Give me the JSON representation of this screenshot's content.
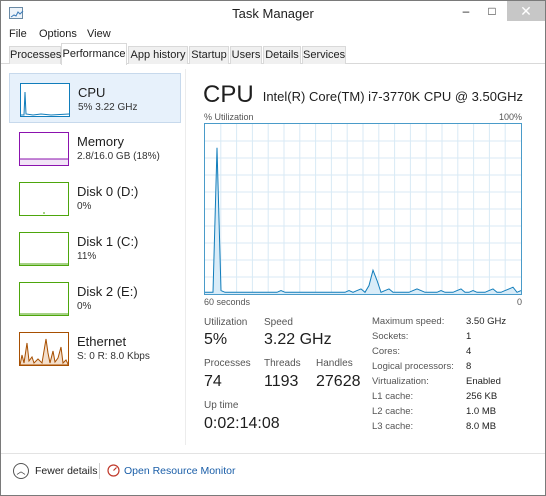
{
  "window": {
    "title": "Task Manager",
    "minimize_glyph": "–",
    "maximize_glyph": "□",
    "close_glyph": "✕"
  },
  "menu": [
    "File",
    "Options",
    "View"
  ],
  "tabs": [
    {
      "label": "Processes",
      "active": false
    },
    {
      "label": "Performance",
      "active": true
    },
    {
      "label": "App history",
      "active": false
    },
    {
      "label": "Startup",
      "active": false
    },
    {
      "label": "Users",
      "active": false
    },
    {
      "label": "Details",
      "active": false
    },
    {
      "label": "Services",
      "active": false
    }
  ],
  "resources": [
    {
      "name": "CPU",
      "sub": "5%  3.22 GHz",
      "color": "#117dbb",
      "selected": true
    },
    {
      "name": "Memory",
      "sub": "2.8/16.0 GB (18%)",
      "color": "#8b12ae",
      "selected": false
    },
    {
      "name": "Disk 0 (D:)",
      "sub": "0%",
      "color": "#4da60c",
      "selected": false
    },
    {
      "name": "Disk 1 (C:)",
      "sub": "11%",
      "color": "#4da60c",
      "selected": false
    },
    {
      "name": "Disk 2 (E:)",
      "sub": "0%",
      "color": "#4da60c",
      "selected": false
    },
    {
      "name": "Ethernet",
      "sub": "S: 0  R: 8.0 Kbps",
      "color": "#a74f01",
      "selected": false
    }
  ],
  "cpu": {
    "title": "CPU",
    "model": "Intel(R) Core(TM) i7-3770K CPU @ 3.50GHz",
    "util_label": "% Utilization",
    "util_max": "100%",
    "axis_left": "60 seconds",
    "axis_right": "0",
    "graph_color": "#117dbb",
    "utilization_history_percent": [
      1,
      1,
      1,
      86,
      2,
      1,
      1,
      1,
      1,
      1,
      1,
      1,
      1,
      1,
      1,
      1,
      1,
      1,
      1,
      2,
      1,
      1,
      1,
      1,
      1,
      1,
      1,
      1,
      1,
      1,
      1,
      1,
      1,
      1,
      1,
      1,
      2,
      1,
      2,
      3,
      1,
      5,
      14,
      8,
      1,
      2,
      3,
      1,
      1,
      1,
      1,
      1,
      2,
      3,
      2,
      1,
      1,
      1,
      1,
      2,
      1,
      1,
      1,
      2,
      3,
      1,
      1,
      2,
      1,
      1,
      1,
      2,
      3,
      1,
      1,
      2,
      3,
      4,
      1,
      2
    ],
    "stats": {
      "utilization_label": "Utilization",
      "utilization": "5%",
      "speed_label": "Speed",
      "speed": "3.22 GHz",
      "processes_label": "Processes",
      "processes": "74",
      "threads_label": "Threads",
      "threads": "1193",
      "handles_label": "Handles",
      "handles": "27628",
      "uptime_label": "Up time",
      "uptime": "0:02:14:08"
    },
    "specs": [
      {
        "label": "Maximum speed:",
        "value": "3.50 GHz"
      },
      {
        "label": "Sockets:",
        "value": "1"
      },
      {
        "label": "Cores:",
        "value": "4"
      },
      {
        "label": "Logical processors:",
        "value": "8"
      },
      {
        "label": "Virtualization:",
        "value": "Enabled"
      },
      {
        "label": "L1 cache:",
        "value": "256 KB"
      },
      {
        "label": "L2 cache:",
        "value": "1.0 MB"
      },
      {
        "label": "L3 cache:",
        "value": "8.0 MB"
      }
    ]
  },
  "footer": {
    "fewer_details": "Fewer details",
    "fewer_glyph": "︿",
    "open_monitor": "Open Resource Monitor"
  },
  "icons": {
    "app": "task-manager-icon",
    "fewer": "chevron-up-icon",
    "monitor": "resource-monitor-icon"
  }
}
